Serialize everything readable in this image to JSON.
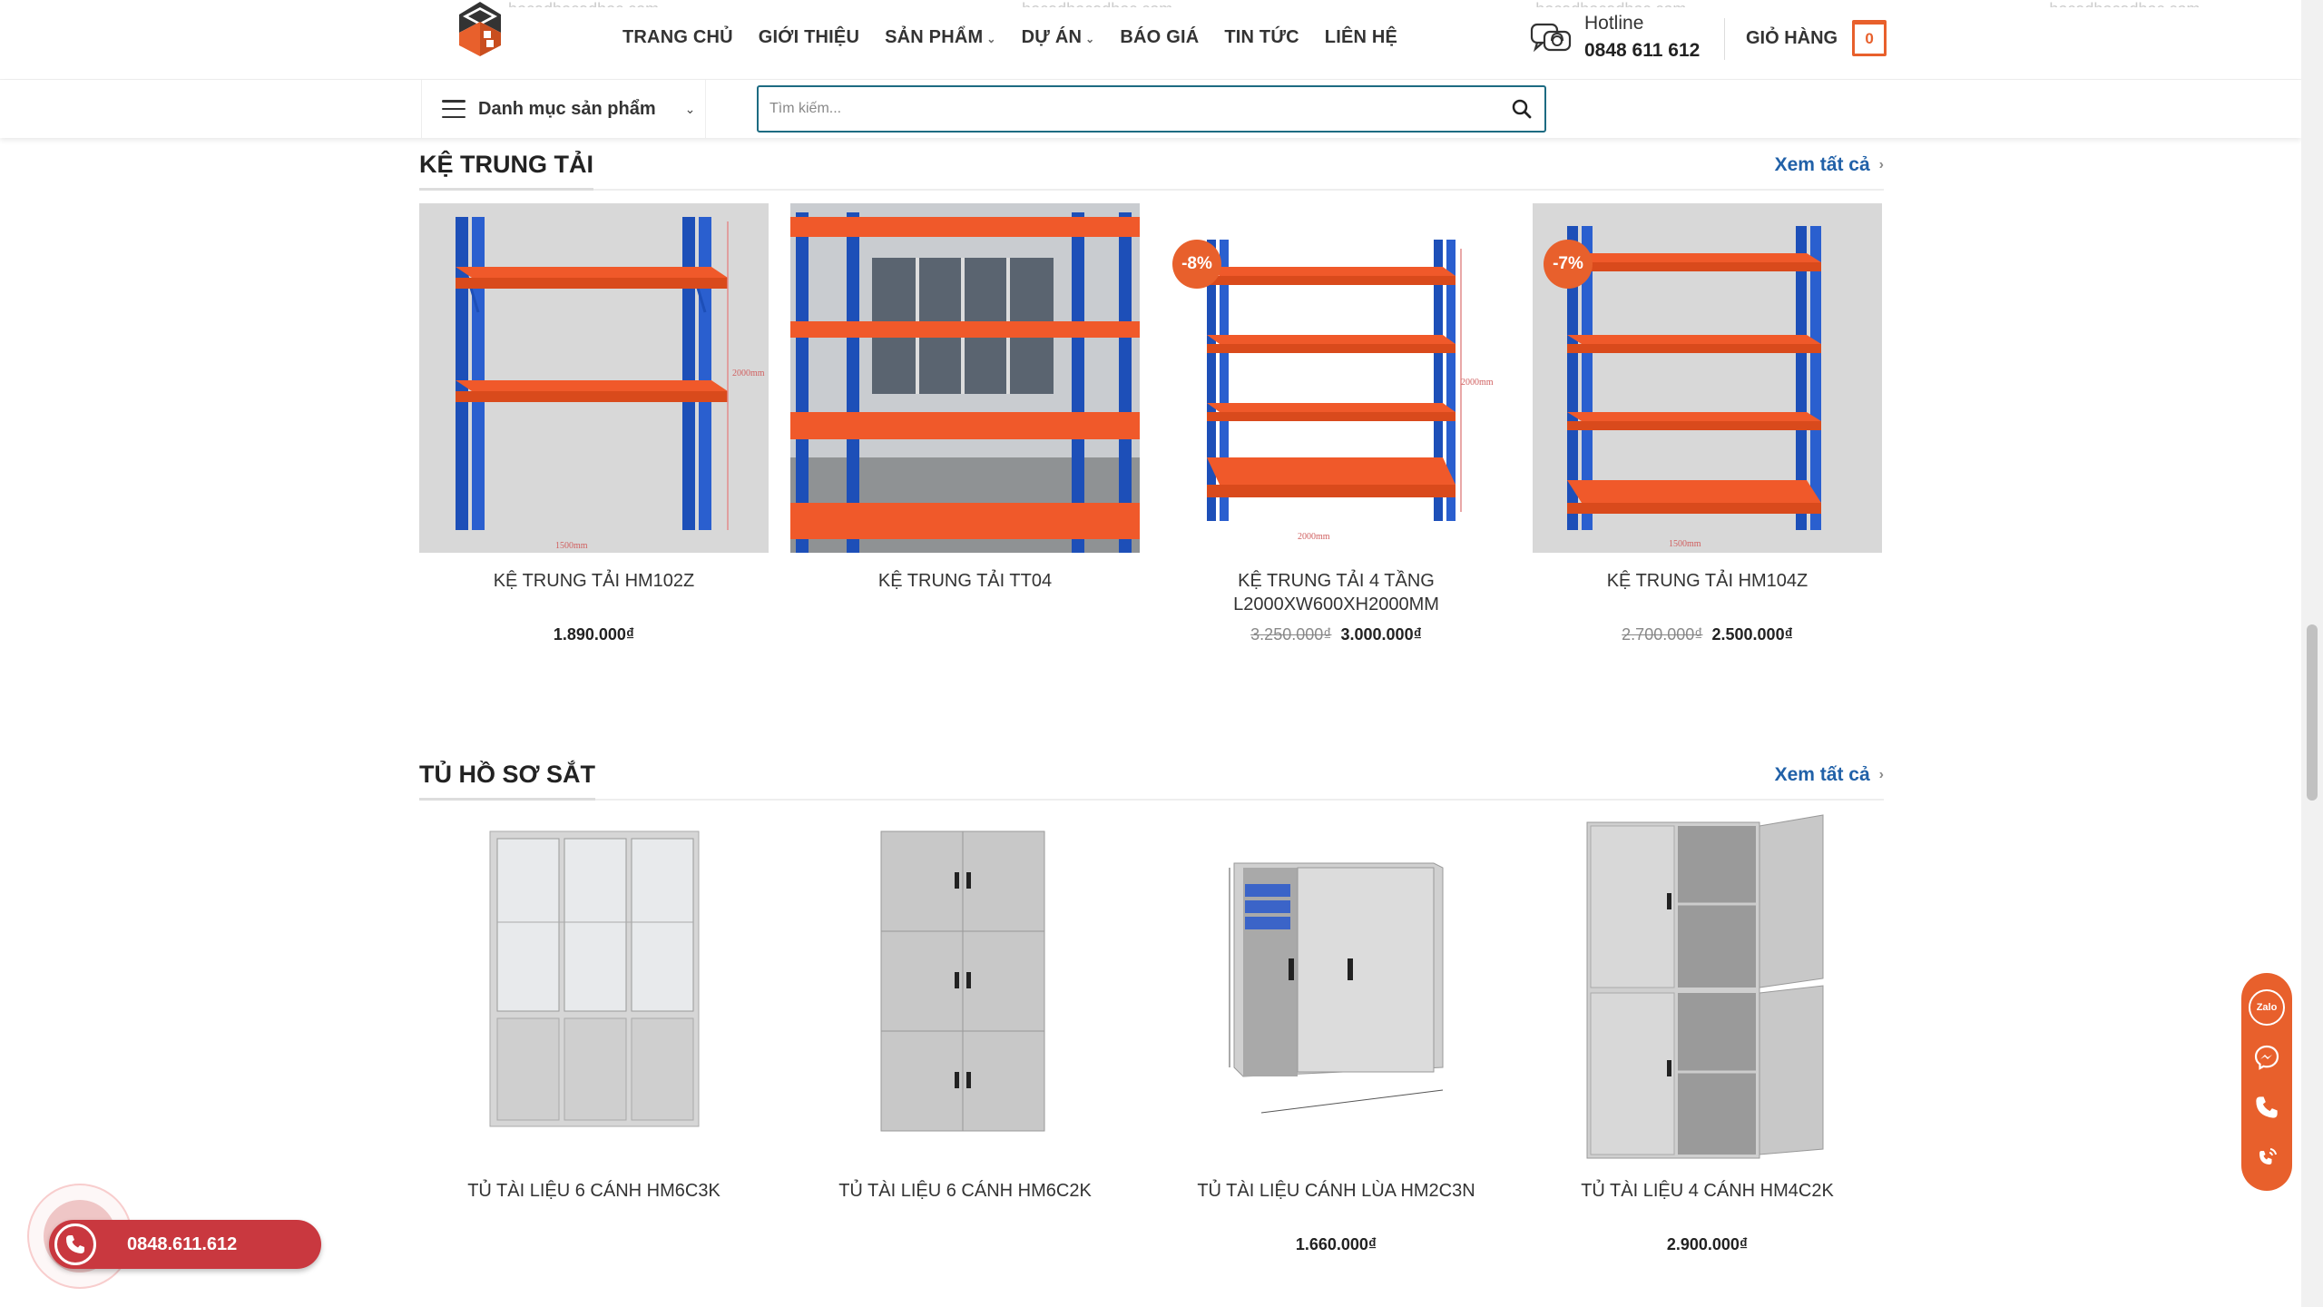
{
  "ghost_texts": [
    "hocadhocadhoc com",
    "hocadhocadhoc com",
    "hocadhocadhoc com",
    "hocadhocadhoc com"
  ],
  "nav": {
    "items": [
      {
        "label": "TRANG CHỦ",
        "has_dropdown": false
      },
      {
        "label": "GIỚI THIỆU",
        "has_dropdown": false
      },
      {
        "label": "SẢN PHẨM",
        "has_dropdown": true
      },
      {
        "label": "DỰ ÁN",
        "has_dropdown": true
      },
      {
        "label": "BÁO GIÁ",
        "has_dropdown": false
      },
      {
        "label": "TIN TỨC",
        "has_dropdown": false
      },
      {
        "label": "LIÊN HỆ",
        "has_dropdown": false
      }
    ]
  },
  "hotline": {
    "label": "Hotline",
    "number": "0848 611 612"
  },
  "cart": {
    "label": "GIỎ HÀNG",
    "count": "0"
  },
  "category_menu": {
    "label": "Danh mục sản phẩm"
  },
  "search": {
    "placeholder": "Tìm kiếm..."
  },
  "sections": [
    {
      "title": "KỆ TRUNG TẢI",
      "more": "Xem tất cả",
      "products": [
        {
          "name": "KỆ TRUNG TẢI HM102Z",
          "old_price": "",
          "price": "1.890.000₫",
          "badge": "",
          "image": "shelf-2-tier"
        },
        {
          "name": "KỆ TRUNG TẢI TT04",
          "old_price": "",
          "price": "",
          "badge": "",
          "image": "shelf-4-tier-warehouse"
        },
        {
          "name": "KỆ TRUNG TẢI 4 TẦNG L2000XW600XH2000MM",
          "old_price": "3.250.000₫",
          "price": "3.000.000₫",
          "badge": "-8%",
          "image": "shelf-4-tier"
        },
        {
          "name": "KỆ TRUNG TẢI HM104Z",
          "old_price": "2.700.000₫",
          "price": "2.500.000₫",
          "badge": "-7%",
          "image": "shelf-4-tier-gray"
        }
      ]
    },
    {
      "title": "TỦ HỒ SƠ SẮT",
      "more": "Xem tất cả",
      "products": [
        {
          "name": "TỦ TÀI LIỆU 6 CÁNH HM6C3K",
          "old_price": "",
          "price": "",
          "badge": "",
          "image": "cabinet-glass-6-door"
        },
        {
          "name": "TỦ TÀI LIỆU 6 CÁNH HM6C2K",
          "old_price": "",
          "price": "",
          "badge": "",
          "image": "cabinet-6-door"
        },
        {
          "name": "TỦ TÀI LIỆU CÁNH LÙA HM2C3N",
          "old_price": "",
          "price": "1.660.000₫",
          "badge": "",
          "image": "cabinet-sliding"
        },
        {
          "name": "TỦ TÀI LIỆU 4 CÁNH HM4C2K",
          "old_price": "",
          "price": "2.900.000₫",
          "badge": "",
          "image": "cabinet-4-door-open"
        }
      ]
    }
  ],
  "call_float": {
    "number": "0848.611.612"
  },
  "side_float": {
    "zalo_label": "Zalo",
    "icons": [
      "zalo-icon",
      "messenger-icon",
      "phone-icon",
      "ringing-phone-icon"
    ]
  },
  "colors": {
    "accent": "#e8602c",
    "link": "#2161a8",
    "search_border": "#1d6b82",
    "call": "#c9383f"
  }
}
